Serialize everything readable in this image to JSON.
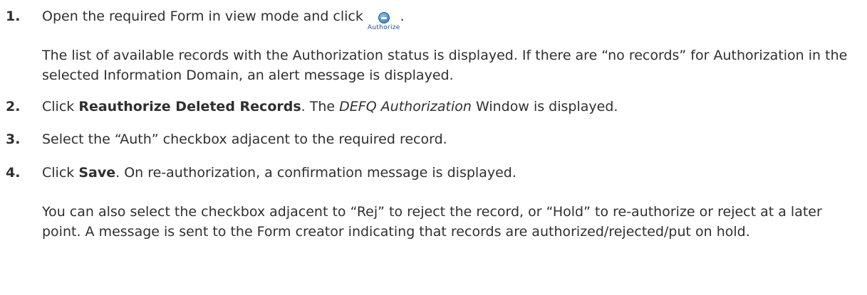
{
  "steps": [
    {
      "num": "1.",
      "text_before": "Open the required Form in view mode and click",
      "button_label": "Authorize",
      "text_after": ".",
      "para1": "The list of available records with the Authorization status is displayed. If there are “no records” for Authorization in the selected Information Domain, an alert message is displayed."
    },
    {
      "num": "2.",
      "text_before": "Click ",
      "bold": "Reauthorize Deleted Records",
      "text_mid": ". The ",
      "italic": "DEFQ Authorization",
      "text_after": " Window is displayed."
    },
    {
      "num": "3.",
      "text": "Select the “Auth” checkbox adjacent to the required record."
    },
    {
      "num": "4.",
      "text_before": "Click ",
      "bold": "Save",
      "text_after": ". On re-authorization, a confirmation message is displayed.",
      "para": "You can also select the checkbox adjacent to “Rej” to reject the record, or “Hold” to re-authorize or reject at a later point. A message is sent to the Form creator indicating that records are authorized/rejected/put on hold."
    }
  ],
  "icons": {
    "authorize": "authorize-icon"
  }
}
